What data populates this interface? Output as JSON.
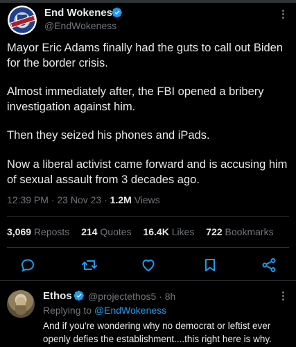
{
  "tweet": {
    "author_name": "End Wokeness",
    "author_handle": "@EndWokeness",
    "paragraphs": [
      [
        "Mayor Eric Adams finally had the guts to call out Biden",
        "for the border crisis."
      ],
      [
        "Almost immediately after, the FBI opened a bribery",
        "investigation against him."
      ],
      [
        "Then they seized his phones and iPads."
      ],
      [
        "Now a liberal activist came forward and is accusing him",
        "of sexual assault from 3 decades ago."
      ]
    ],
    "time": "12:39 PM",
    "date": "23 Nov 23",
    "views_count": "1.2M",
    "views_label": "Views",
    "separator": "·"
  },
  "stats": {
    "reposts": {
      "count": "3,069",
      "label": "Reposts"
    },
    "quotes": {
      "count": "214",
      "label": "Quotes"
    },
    "likes": {
      "count": "16.4K",
      "label": "Likes"
    },
    "bookmarks": {
      "count": "722",
      "label": "Bookmarks"
    }
  },
  "actions": {
    "icons": [
      "reply-icon",
      "repost-icon",
      "like-icon",
      "bookmark-icon",
      "share-icon"
    ]
  },
  "reply": {
    "author_name": "Ethos",
    "handle_time": "@projectethos5 · 8h",
    "replying_prefix": "Replying to",
    "replying_to": "@EndWokeness",
    "text_lines": [
      "And if you're wondering why no democrat or leftist ever",
      "openly defies the establishment....this right here is why."
    ]
  },
  "colors": {
    "background": "#000000",
    "text_primary": "#e7e9ea",
    "text_secondary": "#71767b",
    "accent": "#1d9bf0",
    "divider": "#2f3336"
  }
}
